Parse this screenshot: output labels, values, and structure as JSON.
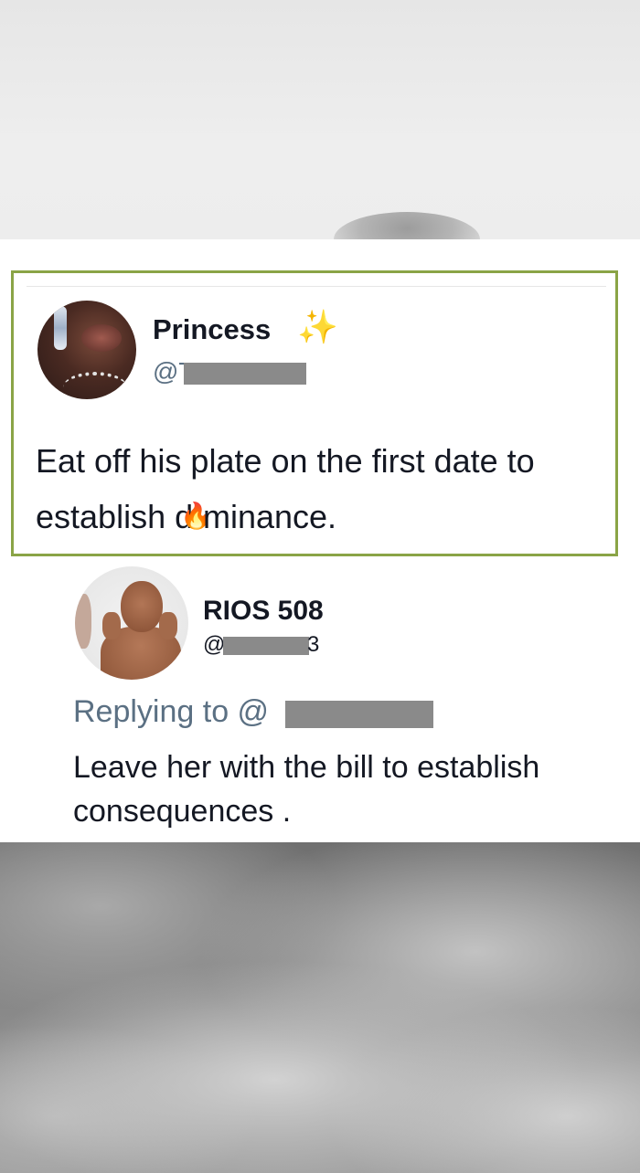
{
  "original_tweet": {
    "display_name": "Princess",
    "name_emoji": "✨",
    "handle_prefix": "@T",
    "text_line1": "Eat off his plate on the first date to",
    "text_line2_part1": "establish d",
    "text_line2_emoji": "🔥",
    "text_line2_part2": "minance.",
    "highlight_color": "#8aa446"
  },
  "reply_tweet": {
    "display_name": "RIOS 508",
    "handle_prefix": "@",
    "handle_suffix": "3",
    "replying_to_prefix": "Replying to @",
    "text_line1": "Leave her with the bill to establish",
    "text_line2": "consequences ."
  },
  "colors": {
    "name_text": "#141823",
    "secondary_text": "#5b7083",
    "redaction": "#8a8a8a"
  }
}
